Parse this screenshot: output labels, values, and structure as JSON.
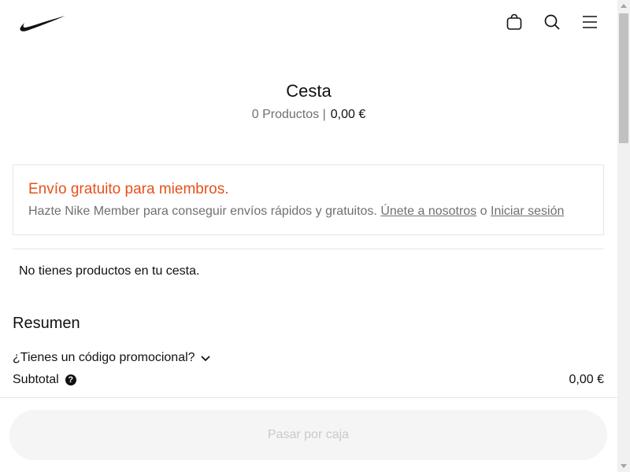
{
  "header": {
    "logo_icon": "nike-swoosh-logo",
    "icons": [
      "bag-icon",
      "search-icon",
      "menu-icon"
    ]
  },
  "cart": {
    "title": "Cesta",
    "count_text": "0 Productos |",
    "total": "0,00 €"
  },
  "banner": {
    "title": "Envío gratuito para miembros.",
    "text": "Hazte Nike Member para conseguir envíos rápidos y gratuitos.",
    "join_link": "Únete a nosotros",
    "or": "o",
    "signin_link": "Iniciar sesión",
    "title_color": "#e5511c"
  },
  "empty_message": "No tienes productos en tu cesta.",
  "summary": {
    "heading": "Resumen",
    "promo_label": "¿Tienes un código promocional?",
    "subtotal_label": "Subtotal",
    "help_glyph": "?",
    "subtotal_value": "0,00 €"
  },
  "checkout": {
    "label": "Pasar por caja",
    "disabled": true
  }
}
